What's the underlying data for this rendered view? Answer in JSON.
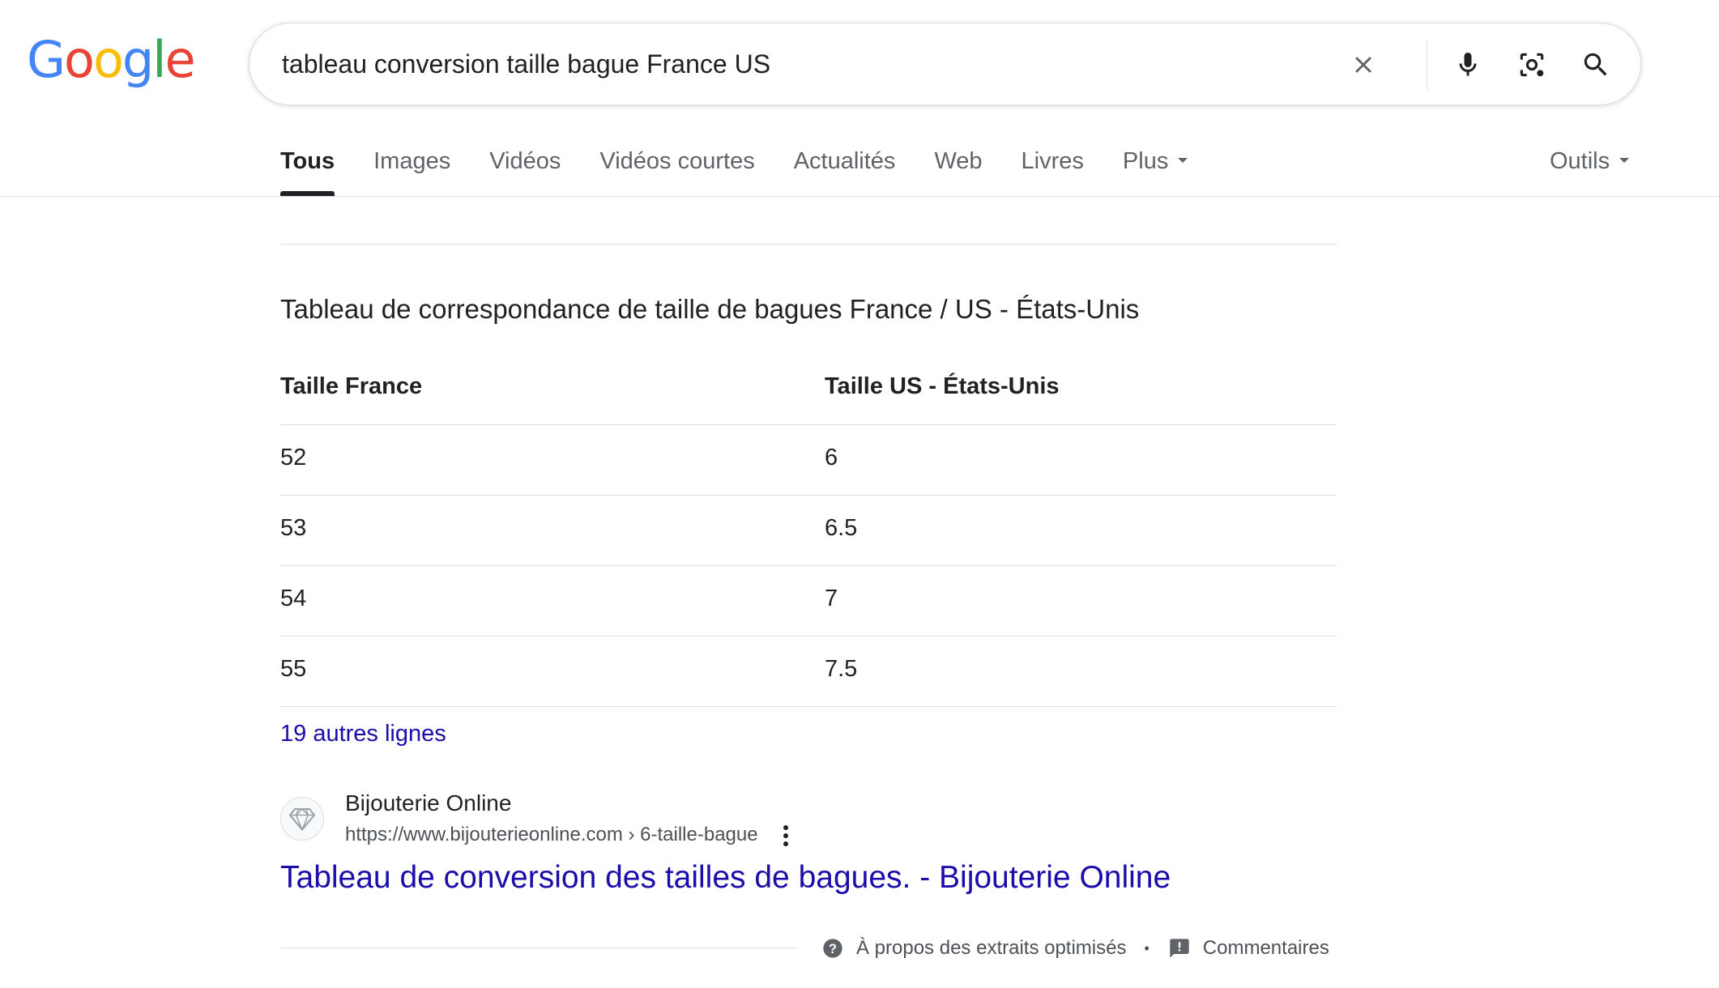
{
  "logo": {
    "letters": [
      "G",
      "o",
      "o",
      "g",
      "l",
      "e"
    ]
  },
  "search": {
    "query": "tableau conversion taille bague France US"
  },
  "icons": {
    "clear": "close-icon",
    "voice": "microphone-icon",
    "lens": "camera-lens-icon",
    "search": "search-icon",
    "more": "more-vert-icon",
    "help": "help-circle-icon",
    "feedback": "feedback-icon"
  },
  "tabs": [
    {
      "label": "Tous",
      "active": true
    },
    {
      "label": "Images",
      "active": false
    },
    {
      "label": "Vidéos",
      "active": false
    },
    {
      "label": "Vidéos courtes",
      "active": false
    },
    {
      "label": "Actualités",
      "active": false
    },
    {
      "label": "Web",
      "active": false
    },
    {
      "label": "Livres",
      "active": false
    },
    {
      "label": "Plus",
      "active": false
    }
  ],
  "tools_label": "Outils",
  "snippet": {
    "heading": "Tableau de correspondance de taille de bagues France / US - États-Unis",
    "columns": [
      "Taille France",
      "Taille US - États-Unis"
    ],
    "rows": [
      [
        "52",
        "6"
      ],
      [
        "53",
        "6.5"
      ],
      [
        "54",
        "7"
      ],
      [
        "55",
        "7.5"
      ]
    ],
    "more_rows_label": "19 autres lignes"
  },
  "source": {
    "site_name": "Bijouterie Online",
    "url": "https://www.bijouterieonline.com › 6-taille-bague",
    "title": "Tableau de conversion des tailles de bagues. - Bijouterie Online"
  },
  "footer": {
    "about_label": "À propos des extraits optimisés",
    "separator": "•",
    "feedback_label": "Commentaires"
  },
  "colors": {
    "link": "#1a0dab",
    "text": "#202124",
    "secondary": "#5f6368",
    "divider": "#dadce0",
    "logo_blue": "#4285f4",
    "logo_red": "#ea4335",
    "logo_yellow": "#fbbc05",
    "logo_green": "#34a853"
  }
}
